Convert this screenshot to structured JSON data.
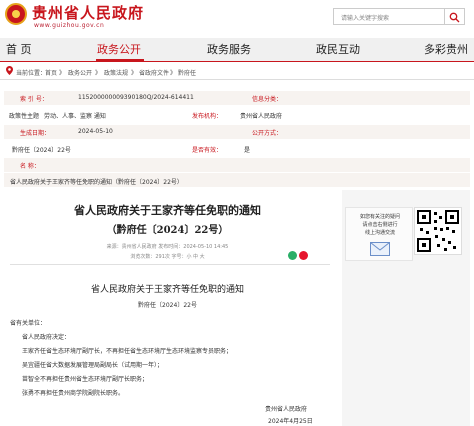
{
  "header": {
    "title": "贵州省人民政府",
    "url": "www.guizhou.gov.cn",
    "search_placeholder": "请输入关键字搜索"
  },
  "nav": [
    "首 页",
    "政务公开",
    "政务服务",
    "政民互动",
    "多彩贵州"
  ],
  "breadcrumb": [
    "当前位置：",
    "首页",
    "》",
    "政务公开",
    "》",
    "政策法规",
    "》",
    "省政府文件",
    "》",
    "黔府任"
  ],
  "meta": {
    "rows": [
      {
        "k1": "索  引  号：",
        "v1": "115200000009390180Q/2024-614411",
        "k2": "信息分类：",
        "v2": ""
      },
      {
        "k1": "政策性主题",
        "v1": "劳动、人事、监察    通知",
        "k2": "发布机构：",
        "v2": "贵州省人民政府"
      },
      {
        "k1": "生成日期：",
        "v1": "2024-05-10",
        "k2": "公开方式：",
        "v2": ""
      },
      {
        "k1": "黔府任〔2024〕22号",
        "v1": "",
        "k2": "是否有效：",
        "v2": "是"
      },
      {
        "k1": "名      称：",
        "v1": "",
        "k2": "",
        "v2": ""
      }
    ],
    "name_value": "省人民政府关于王家齐等任免职的通知（黔府任〔2024〕22号）"
  },
  "article": {
    "title": "省人民政府关于王家齐等任免职的通知",
    "subtitle": "（黔府任〔2024〕22号）",
    "info": "来源：贵州省人民政府    发布时间：2024-05-10 14:45",
    "info2": "浏览次数：291次    字号：小  中  大",
    "doc_title": "省人民政府关于王家齐等任免职的通知",
    "doc_no": "黔府任〔2024〕22号",
    "recipient": "省有关单位：",
    "paras": [
      "省人民政府决定：",
      "王家齐任省生态环境厅副厅长，不再担任省生态环境厅生态环境监察专员职务；",
      "吴宜疆任省大数据发展管理局副局长（试用期一年）；",
      "苗智全不再担任贵州省生态环境厅副厅长职务；",
      "张勇不再担任贵州商学院副院长职务。"
    ],
    "sign": "贵州省人民政府",
    "sign_date": "2024年4月25日"
  },
  "sidebar": {
    "ad_text": "如您有关注的疑问\n请点击右侧进行\n线上沟通交流"
  },
  "colors": {
    "brand": "#c8161d",
    "gold": "#e6a21b"
  }
}
